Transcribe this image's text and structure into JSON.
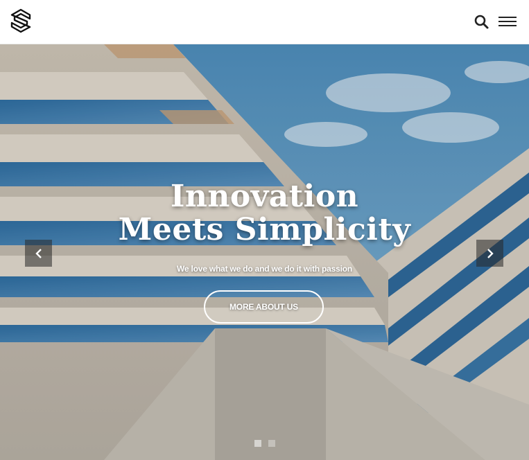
{
  "header": {
    "logo_icon": "s-logo-icon",
    "search_icon": "search-icon",
    "menu_icon": "hamburger-menu-icon"
  },
  "hero": {
    "headline_line1": "Innovation",
    "headline_line2": "Meets Simplicity",
    "subline": "We love what we do and we do it with passion",
    "cta_label": "MORE ABOUT US",
    "prev_icon": "chevron-left-icon",
    "next_icon": "chevron-right-icon",
    "slide_count": 2,
    "active_slide": 1
  },
  "colors": {
    "sky": "#5c9bc4",
    "building": "#d9d2c5",
    "glass": "#3f7fb0",
    "text": "#ffffff"
  }
}
